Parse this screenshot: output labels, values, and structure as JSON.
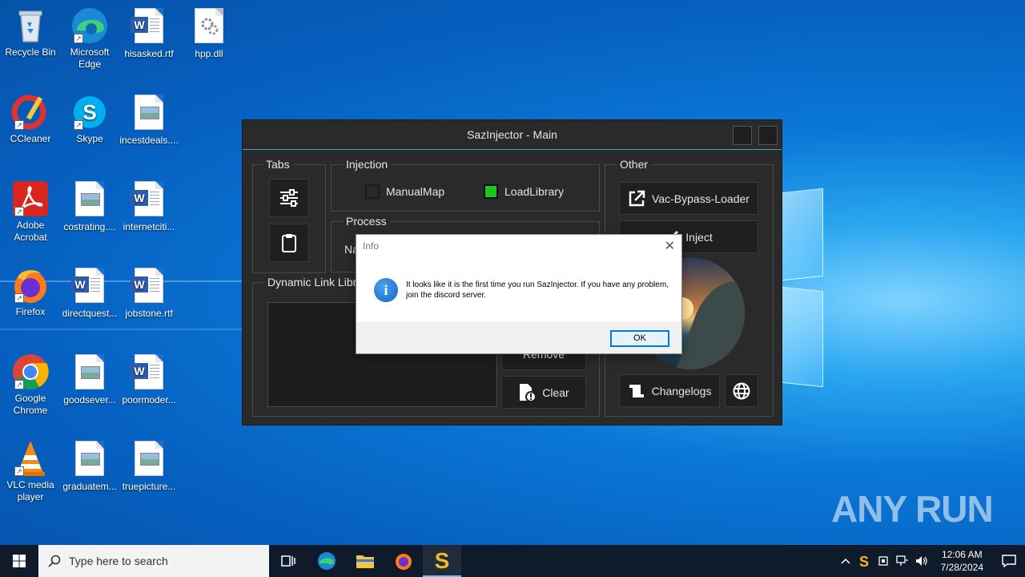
{
  "desktop_icons": [
    {
      "label": "Recycle Bin",
      "icon": "recycle-bin-icon"
    },
    {
      "label": "Microsoft Edge",
      "icon": "edge-icon"
    },
    {
      "label": "hisasked.rtf",
      "icon": "word-doc-icon"
    },
    {
      "label": "hpp.dll",
      "icon": "dll-file-icon"
    },
    {
      "label": "CCleaner",
      "icon": "ccleaner-icon"
    },
    {
      "label": "Skype",
      "icon": "skype-icon"
    },
    {
      "label": "incestdeals....",
      "icon": "image-file-icon"
    },
    {
      "label": "Adobe Acrobat",
      "icon": "acrobat-icon"
    },
    {
      "label": "costrating....",
      "icon": "image-file-icon"
    },
    {
      "label": "internetciti...",
      "icon": "word-doc-icon"
    },
    {
      "label": "Firefox",
      "icon": "firefox-icon"
    },
    {
      "label": "directquest...",
      "icon": "word-doc-icon"
    },
    {
      "label": "jobstone.rtf",
      "icon": "word-doc-icon"
    },
    {
      "label": "Google Chrome",
      "icon": "chrome-icon"
    },
    {
      "label": "goodsever...",
      "icon": "image-file-icon"
    },
    {
      "label": "poormoder...",
      "icon": "word-doc-icon"
    },
    {
      "label": "VLC media player",
      "icon": "vlc-icon"
    },
    {
      "label": "graduatem...",
      "icon": "image-file-icon"
    },
    {
      "label": "truepicture...",
      "icon": "image-file-icon"
    }
  ],
  "app": {
    "title": "SazInjector - Main",
    "tabs_label": "Tabs",
    "injection_label": "Injection",
    "manualmap_label": "ManualMap",
    "manualmap_checked": false,
    "loadlibrary_label": "LoadLibrary",
    "loadlibrary_checked": true,
    "process_label": "Process",
    "process_name_partial": "Na",
    "dll_label": "Dynamic Link Libra",
    "remove_label": "Remove",
    "clear_label": "Clear",
    "other_label": "Other",
    "vac_label": "Vac-Bypass-Loader",
    "inject_label": "Inject",
    "changelogs_label": "Changelogs",
    "accent_color": "#2fa8d5",
    "checked_color": "#1ec41e"
  },
  "dialog": {
    "title": "Info",
    "message": "It looks like it is the first time you run SazInjector. If you have any problem, join the discord server.",
    "ok_label": "OK",
    "icon": "info-icon"
  },
  "taskbar": {
    "search_placeholder": "Type here to search",
    "time": "12:06 AM",
    "date": "7/28/2024"
  },
  "watermark": "ANY RUN"
}
